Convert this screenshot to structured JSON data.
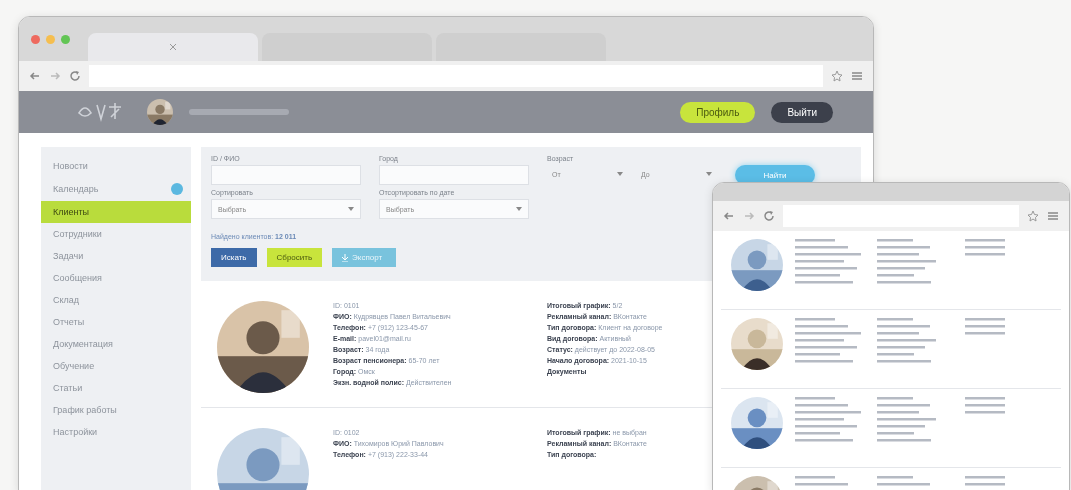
{
  "main_window": {
    "tabs": [
      {
        "selected": true
      },
      {
        "selected": false
      },
      {
        "selected": false
      }
    ],
    "header": {
      "buttons": [
        {
          "label": "Профиль",
          "kind": "primary"
        },
        {
          "label": "Выйти",
          "kind": "dark"
        }
      ]
    },
    "sidebar": {
      "items": [
        {
          "label": "Новости",
          "selected": false
        },
        {
          "label": "Календарь",
          "selected": false,
          "badge": true
        },
        {
          "label": "Клиенты",
          "selected": true
        },
        {
          "label": "Сотрудники",
          "selected": false
        },
        {
          "label": "Задачи",
          "selected": false
        },
        {
          "label": "Сообщения",
          "selected": false
        },
        {
          "label": "Склад",
          "selected": false
        },
        {
          "label": "Отчеты",
          "selected": false
        },
        {
          "label": "Документация",
          "selected": false
        },
        {
          "label": "Обучение",
          "selected": false
        },
        {
          "label": "Статьи",
          "selected": false
        },
        {
          "label": "График работы",
          "selected": false
        },
        {
          "label": "Настройки",
          "selected": false
        }
      ]
    },
    "filters": {
      "fields": [
        {
          "label": "ID / ФИО"
        },
        {
          "label": "Город"
        }
      ],
      "age": {
        "label": "Возраст",
        "from": "От",
        "to": "До"
      },
      "find_button": "Найти",
      "selects": [
        {
          "label": "Сортировать",
          "value": "Выбрать"
        },
        {
          "label": "Отсортировать по дате",
          "value": "Выбрать"
        }
      ],
      "count": "Найдено клиентов: **12 011**",
      "buttons": [
        {
          "label": "Искать",
          "kind": "primary"
        },
        {
          "label": "Сбросить",
          "kind": "accent"
        },
        {
          "label": "Экспорт",
          "kind": "export"
        }
      ]
    },
    "clients": [
      {
        "left": [
          "ID: 0101",
          "**ФИО:** Кудрявцев Павел Витальевич",
          "**Телефон:** +7 (912) 123-45-67",
          "**E-mail:** pavel01@mail.ru",
          "**Возраст:** 34 года",
          "**Возраст пенсионера:** 65-70 лет",
          "**Город:** Омск",
          "**Экзн. водной полис:** Действителен"
        ],
        "right": [
          "**Итоговый график:** 5/2",
          "**Рекламный канал:** ВКонтакте",
          "**Тип договора:** Клиент на договоре",
          "**Вид договора:** Активный",
          "**Статус:** действует до 2022-08-05",
          "**Начало договора:** 2021-10-15",
          "**Документы**"
        ]
      },
      {
        "left": [
          "ID: 0102",
          "**ФИО:** Тихомиров Юрий Павлович",
          "**Телефон:** +7 (913) 222-33-44"
        ],
        "right": [
          "**Итоговый график:** не выбран",
          "**Рекламный канал:** ВКонтакте",
          "**Тип договора:**"
        ]
      }
    ]
  }
}
